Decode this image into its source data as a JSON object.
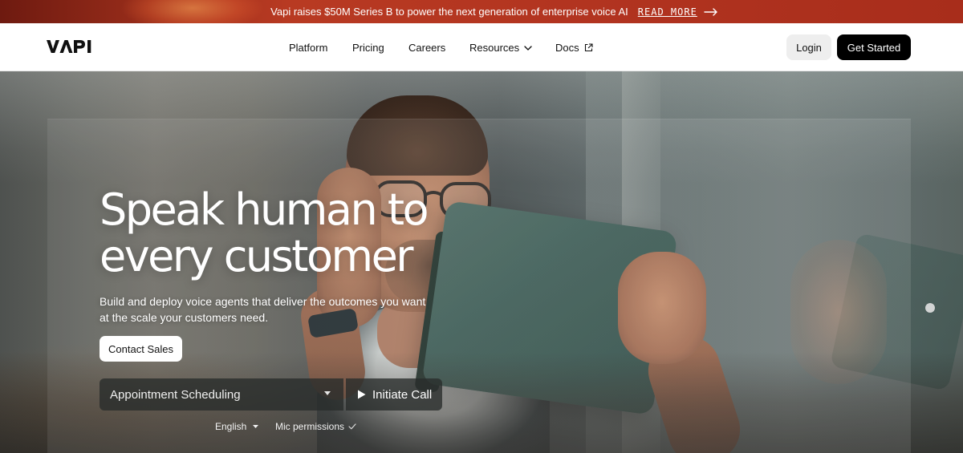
{
  "banner": {
    "text": "Vapi raises $50M Series B to power the next generation of enterprise voice AI",
    "link_label": "READ MORE",
    "arrow_icon": "arrow-right-icon",
    "background_color": "#b23420"
  },
  "nav": {
    "logo_text": "VAPI",
    "links": [
      {
        "label": "Platform"
      },
      {
        "label": "Pricing"
      },
      {
        "label": "Careers"
      },
      {
        "label": "Resources",
        "icon": "chevron-down-icon"
      },
      {
        "label": "Docs",
        "icon": "external-link-icon"
      }
    ],
    "login_label": "Login",
    "get_started_label": "Get Started"
  },
  "hero": {
    "title_line1": "Speak human to",
    "title_line2": "every customer",
    "subtitle": "Build and deploy voice agents that deliver the outcomes you want at the scale your customers need.",
    "contact_label": "Contact Sales",
    "demo": {
      "selected_use_case": "Appointment Scheduling",
      "call_label": "Initiate Call",
      "language": "English",
      "mic_label": "Mic permissions"
    }
  },
  "colors": {
    "accent_dark": "#000000",
    "login_bg": "#eeeeee",
    "text_primary": "#111111"
  }
}
